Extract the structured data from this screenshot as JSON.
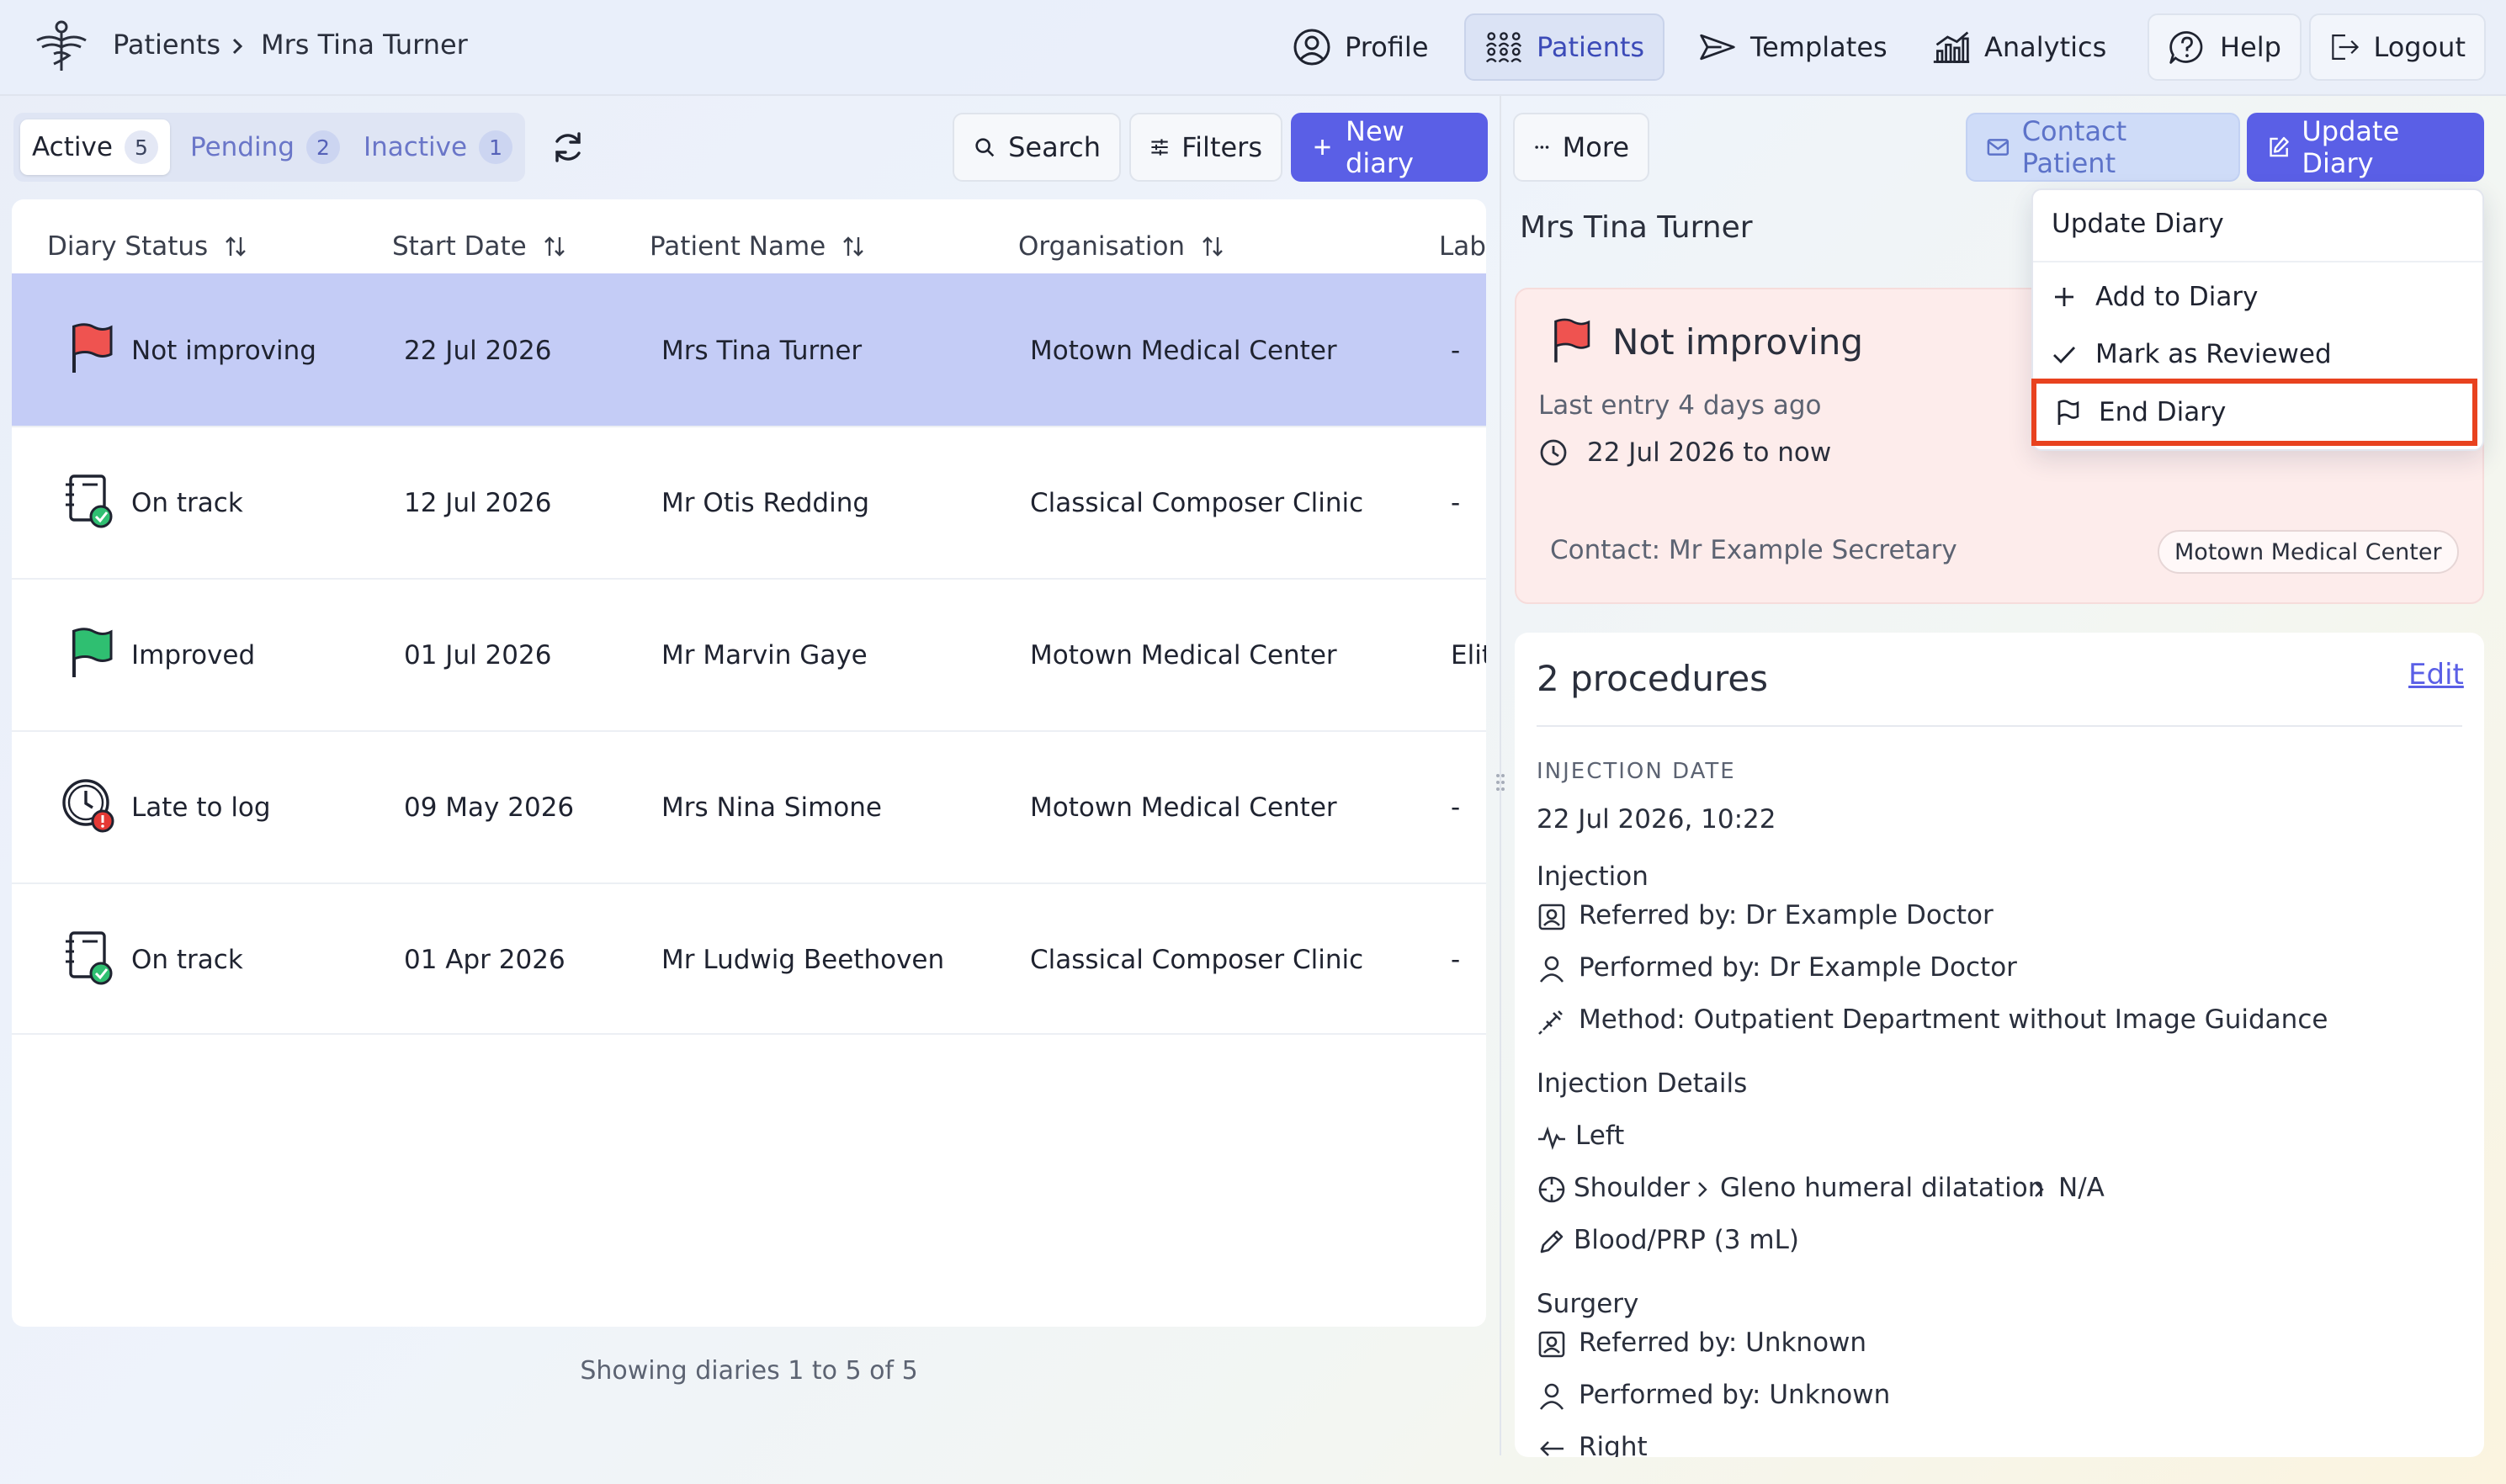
{
  "header": {
    "breadcrumb": {
      "root": "Patients",
      "current": "Mrs Tina Turner"
    },
    "nav": {
      "profile": "Profile",
      "patients": "Patients",
      "templates": "Templates",
      "analytics": "Analytics",
      "help": "Help",
      "logout": "Logout"
    }
  },
  "tabs": [
    {
      "label": "Active",
      "count": "5"
    },
    {
      "label": "Pending",
      "count": "2"
    },
    {
      "label": "Inactive",
      "count": "1"
    }
  ],
  "toolbar": {
    "search": "Search",
    "filters": "Filters",
    "new_diary": "New diary",
    "more": "More"
  },
  "table": {
    "columns": [
      "Diary Status",
      "Start Date",
      "Patient Name",
      "Organisation",
      "Lab"
    ],
    "rows": [
      {
        "status": "Not improving",
        "status_icon": "red-flag-icon",
        "start": "22 Jul 2026",
        "patient": "Mrs Tina Turner",
        "org": "Motown Medical Center",
        "lab": "-"
      },
      {
        "status": "On track",
        "status_icon": "diary-check-icon",
        "start": "12 Jul 2026",
        "patient": "Mr Otis Redding",
        "org": "Classical Composer Clinic",
        "lab": "-"
      },
      {
        "status": "Improved",
        "status_icon": "green-flag-icon",
        "start": "01 Jul 2026",
        "patient": "Mr Marvin Gaye",
        "org": "Motown Medical Center",
        "lab": "Elit"
      },
      {
        "status": "Late to log",
        "status_icon": "late-clock-icon",
        "start": "09 May 2026",
        "patient": "Mrs Nina Simone",
        "org": "Motown Medical Center",
        "lab": "-"
      },
      {
        "status": "On track",
        "status_icon": "diary-check-icon",
        "start": "01 Apr 2026",
        "patient": "Mr Ludwig Beethoven",
        "org": "Classical Composer Clinic",
        "lab": "-"
      }
    ],
    "footer": "Showing diaries 1 to 5 of 5"
  },
  "actions": {
    "contact_patient": "Contact Patient",
    "update_diary": "Update Diary"
  },
  "dropdown": {
    "title": "Update Diary",
    "items": [
      {
        "label": "Add to Diary",
        "icon": "plus-icon"
      },
      {
        "label": "Mark as Reviewed",
        "icon": "check-icon"
      },
      {
        "label": "End Diary",
        "icon": "flag-outline-icon"
      }
    ]
  },
  "detail": {
    "patient_name": "Mrs Tina Turner",
    "status": "Not improving",
    "last_entry": "Last entry 4 days ago",
    "date_range": "22 Jul 2026 to now",
    "contact": "Contact: Mr Example Secretary",
    "organisation": "Motown Medical Center",
    "procedures_title": "2 procedures",
    "edit": "Edit",
    "injection_date_label": "INJECTION DATE",
    "injection_date": "22 Jul 2026, 10:22",
    "injection": {
      "title": "Injection",
      "referred_by": "Referred by: Dr Example Doctor",
      "performed_by": "Performed by: Dr Example Doctor",
      "method": "Method: Outpatient Department without Image Guidance"
    },
    "injection_details": {
      "title": "Injection Details",
      "side": "Left",
      "site": "Shoulder",
      "site_sub": "Gleno humeral dilatation",
      "site_detail": "N/A",
      "substance": "Blood/PRP (3 mL)"
    },
    "surgery": {
      "title": "Surgery",
      "referred_by": "Referred by: Unknown",
      "performed_by": "Performed by: Unknown",
      "side": "Right"
    }
  },
  "colors": {
    "accent": "#5a5fe6",
    "selected_row": "#c4ccf6",
    "alert_card": "#fdeceb",
    "flag_red": "#ef5350",
    "flag_green": "#2fbf71",
    "highlight_border": "#e8421f"
  }
}
